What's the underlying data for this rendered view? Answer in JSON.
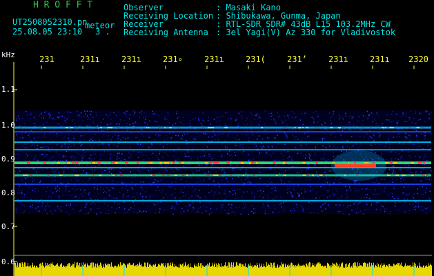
{
  "header": {
    "brand": "H R O F F T",
    "filename": "UT2508052310.pn",
    "mode": "meteor",
    "datetime": "25.08.05 23:10",
    "index": "3 .",
    "labels": [
      "Observer",
      "Receiving Location",
      "Receiver",
      "Receiving Antenna"
    ],
    "values": [
      ": Masaki Kano",
      ": Shibukawa, Gunma, Japan",
      ": RTL-SDR SDR# 43dB L15 103.2MHz CW",
      ": 3el Yagi(V) Az 330 for Vladivostok"
    ]
  },
  "spectrogram": {
    "y_unit": "kHz",
    "y_ticks": [
      "1.1",
      "1.0",
      "0.9",
      "0.8",
      "0.7",
      "0.6"
    ],
    "time_ticks": [
      "231",
      "231ı",
      "231ı",
      "231∘",
      "231ı",
      "231(",
      "231’",
      "231ı",
      "231ı",
      "2320"
    ],
    "colors": {
      "axis": "#ffff33",
      "grid": "#ffffff",
      "signal_low": "#1010a0",
      "signal_mid": "#00e0ff",
      "signal_peak": "#ff2020",
      "meter": "#e6d800"
    }
  }
}
